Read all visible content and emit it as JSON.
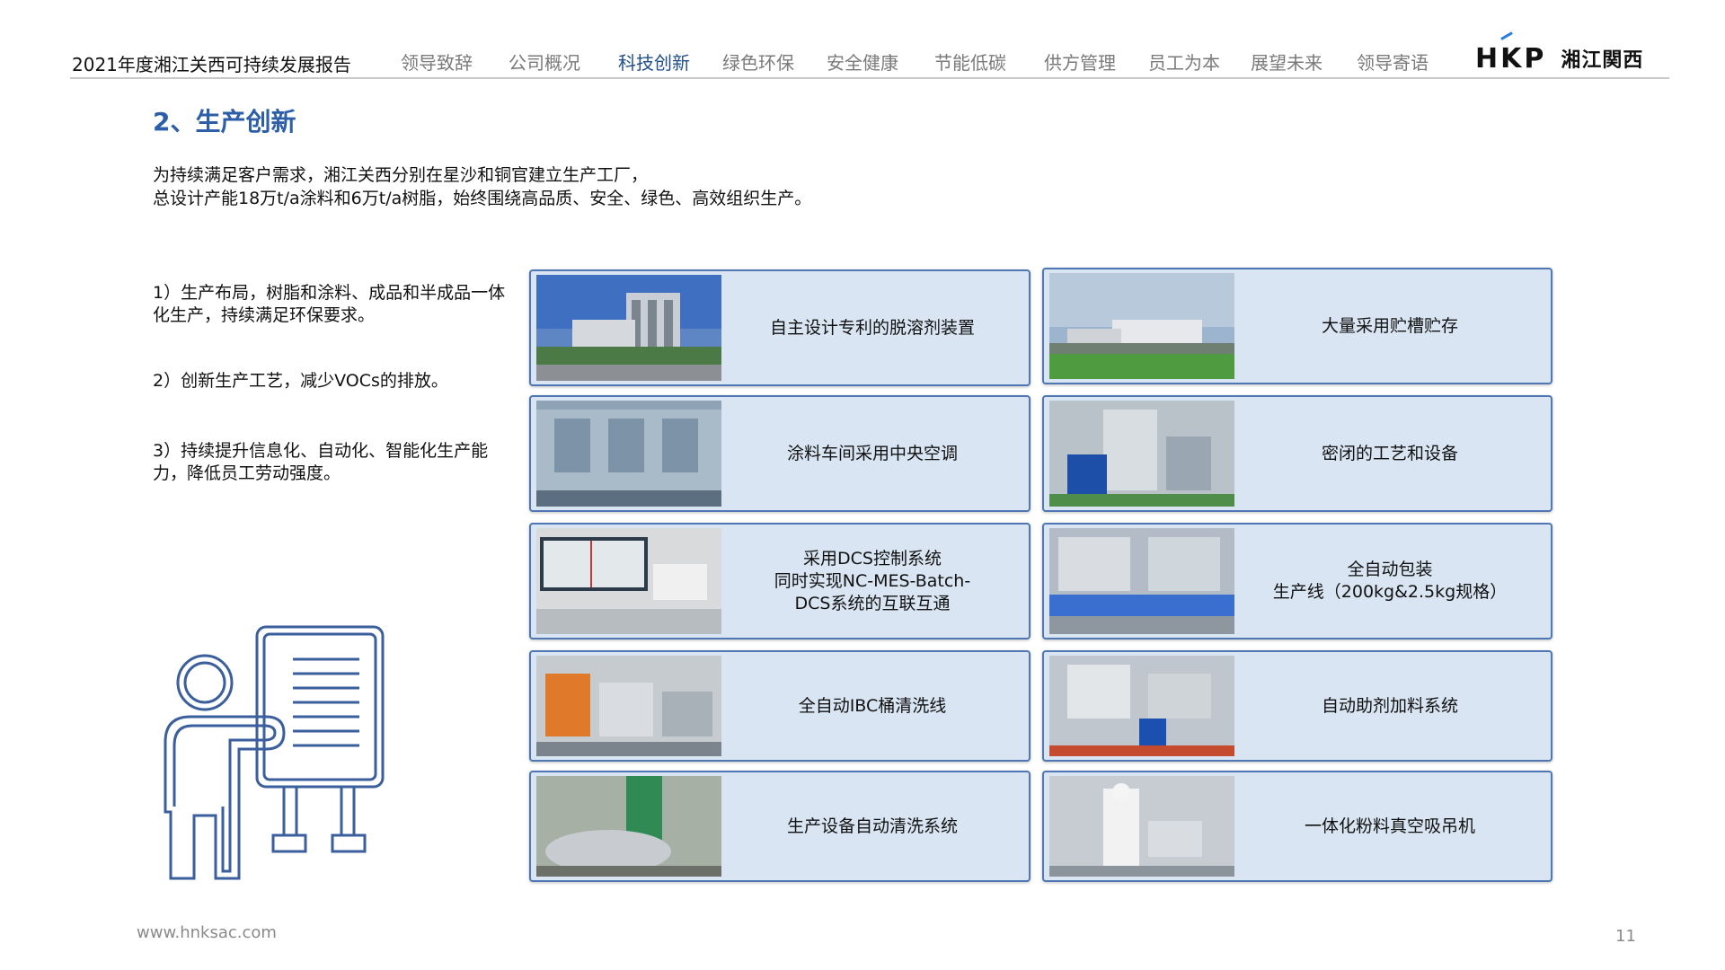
{
  "header": {
    "report_title": "2021年度湘江关西可持续发展报告",
    "nav": [
      {
        "label": "领导致辞"
      },
      {
        "label": "公司概况"
      },
      {
        "label": "科技创新"
      },
      {
        "label": "绿色环保"
      },
      {
        "label": "安全健康"
      },
      {
        "label": "节能低碳"
      },
      {
        "label": "供方管理"
      },
      {
        "label": "员工为本"
      },
      {
        "label": "展望未来"
      },
      {
        "label": "领导寄语"
      }
    ],
    "active_nav": "科技创新",
    "logo": {
      "mark": "HKP",
      "name": "湘江関西"
    }
  },
  "section": {
    "title": "2、生产创新",
    "intro_line1": "为持续满足客户需求，湘江关西分别在星沙和铜官建立生产工厂，",
    "intro_line2": "总设计产能18万t/a涂料和6万t/a树脂，始终围绕高品质、安全、绿色、高效组织生产。"
  },
  "points": [
    "1）生产布局，树脂和涂料、成品和半成品一体化生产，持续满足环保要求。",
    "2）创新生产工艺，减少VOCs的排放。",
    "3）持续提升信息化、自动化、智能化生产能力，降低员工劳动强度。"
  ],
  "cards": [
    {
      "caption": "自主设计专利的脱溶剂装置"
    },
    {
      "caption": "大量采用贮槽贮存"
    },
    {
      "caption": "涂料车间采用中央空调"
    },
    {
      "caption": "密闭的工艺和设备"
    },
    {
      "caption": "采用DCS控制系统\n同时实现NC-MES-Batch-\nDCS系统的互联互通"
    },
    {
      "caption": "全自动包装\n生产线（200kg&2.5kg规格）"
    },
    {
      "caption": "全自动IBC桶清洗线"
    },
    {
      "caption": "自动助剂加料系统"
    },
    {
      "caption": "生产设备自动清洗系统"
    },
    {
      "caption": "一体化粉料真空吸吊机"
    }
  ],
  "footer": {
    "url": "www.hnksac.com",
    "page": "11"
  },
  "colors": {
    "accent": "#2d5ea8",
    "card_bg": "#d9e5f2",
    "card_border": "#4e77b3",
    "nav_active": "#1f4e8a"
  }
}
